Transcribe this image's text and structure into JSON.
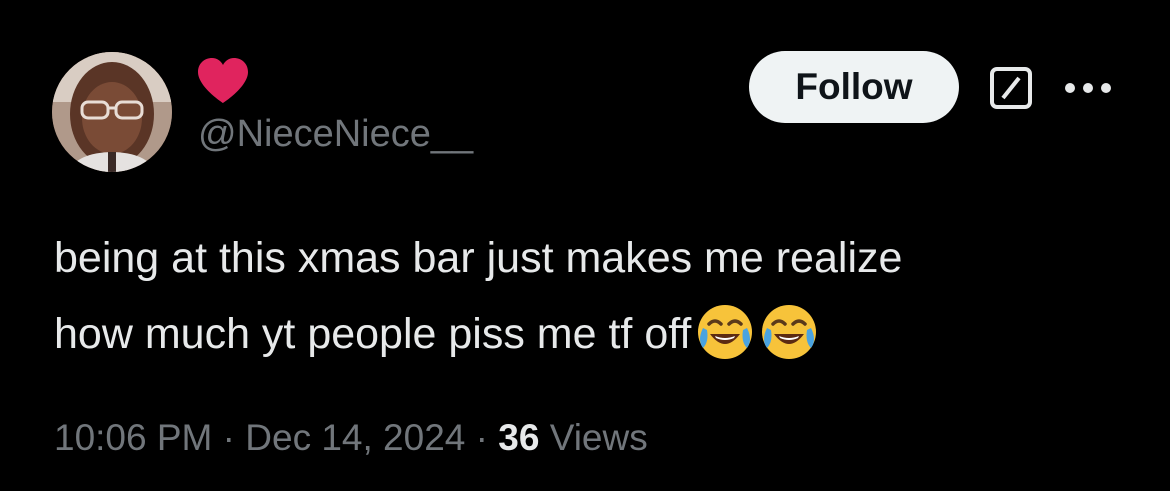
{
  "author": {
    "handle": "@NieceNiece__",
    "name_icon": "heart-icon",
    "name_icon_color": "#e0245e"
  },
  "actions": {
    "follow_label": "Follow",
    "grok_icon": "grok-icon",
    "more_icon": "more-icon"
  },
  "tweet": {
    "line1": "being at this xmas bar just makes me realize",
    "line2": "how much yt people piss me tf off",
    "emojis": [
      "face-with-tears-of-joy-icon",
      "face-with-tears-of-joy-icon"
    ]
  },
  "meta": {
    "time": "10:06 PM",
    "separator": "·",
    "date": "Dec 14, 2024",
    "views_count": "36",
    "views_label": "Views"
  },
  "colors": {
    "background": "#000000",
    "text": "#e7e9ea",
    "secondary": "#71767b",
    "follow_bg": "#eff3f4"
  }
}
